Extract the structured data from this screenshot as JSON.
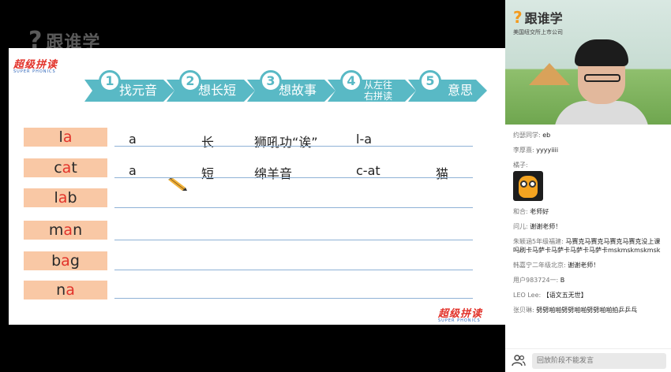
{
  "watermark": {
    "icon": "question-mark-logo",
    "text": "跟谁学"
  },
  "slide": {
    "logo_text": "超级拼读",
    "logo_sub": "SUPER PHONICS",
    "steps": [
      {
        "num": "1",
        "label": "找元音"
      },
      {
        "num": "2",
        "label": "想长短"
      },
      {
        "num": "3",
        "label": "想故事"
      },
      {
        "num": "4",
        "label_line1": "从左往",
        "label_line2": "右拼读"
      },
      {
        "num": "5",
        "label": "意思"
      }
    ],
    "rows": [
      {
        "pre": "l",
        "vowel": "a",
        "post": "",
        "vowel_col": "a",
        "length": "长",
        "story": "狮吼功“诶”",
        "blend": "l-a",
        "meaning": ""
      },
      {
        "pre": "c",
        "vowel": "a",
        "post": "t",
        "vowel_col": "a",
        "length": "短",
        "story": "绵羊音",
        "blend": "c-at",
        "meaning": "猫"
      },
      {
        "pre": "l",
        "vowel": "a",
        "post": "b",
        "vowel_col": "",
        "length": "",
        "story": "",
        "blend": "",
        "meaning": ""
      },
      {
        "pre": "m",
        "vowel": "a",
        "post": "n",
        "vowel_col": "",
        "length": "",
        "story": "",
        "blend": "",
        "meaning": ""
      },
      {
        "pre": "b",
        "vowel": "a",
        "post": "g",
        "vowel_col": "",
        "length": "",
        "story": "",
        "blend": "",
        "meaning": ""
      },
      {
        "pre": "n",
        "vowel": "a",
        "post": "",
        "vowel_col": "",
        "length": "",
        "story": "",
        "blend": "",
        "meaning": ""
      }
    ],
    "cursor_icon": "pencil-icon"
  },
  "panel": {
    "brand": {
      "name": "跟谁学",
      "sub": "美国纽交所上市公司"
    },
    "messages": [
      {
        "user": "约瑟同学:",
        "text": "eb"
      },
      {
        "user": "李厚熹:",
        "text": "yyyyiiii"
      },
      {
        "user": "橘子:",
        "text": "",
        "sticker": "owl-sticker"
      },
      {
        "user": "和合:",
        "text": "老师好"
      },
      {
        "user": "问儿:",
        "text": "谢谢老师！"
      },
      {
        "user": "朱颖涵5年级福建:",
        "text": "马赛克马赛克马赛克马赛克没上课吗刷卡马萨卡马萨卡马萨卡马萨卡mskmskmskmsk"
      },
      {
        "user": "韩嘉宁二年级北京:",
        "text": "谢谢老师！"
      },
      {
        "user": "用户983724一:",
        "text": "B"
      },
      {
        "user": "LEO Lee:",
        "text": "【语文五无世】"
      },
      {
        "user": "张贝琳:",
        "text": "劈劈啪啪劈劈啪啪劈劈啪啪拍乒乒乓"
      }
    ],
    "input_placeholder": "回放阶段不能发言",
    "people_icon": "people-icon"
  },
  "colors": {
    "step": "#59b9c5",
    "word_bg": "#f9c8a5",
    "vowel": "#e2332b",
    "rule": "#8fb2d6"
  }
}
